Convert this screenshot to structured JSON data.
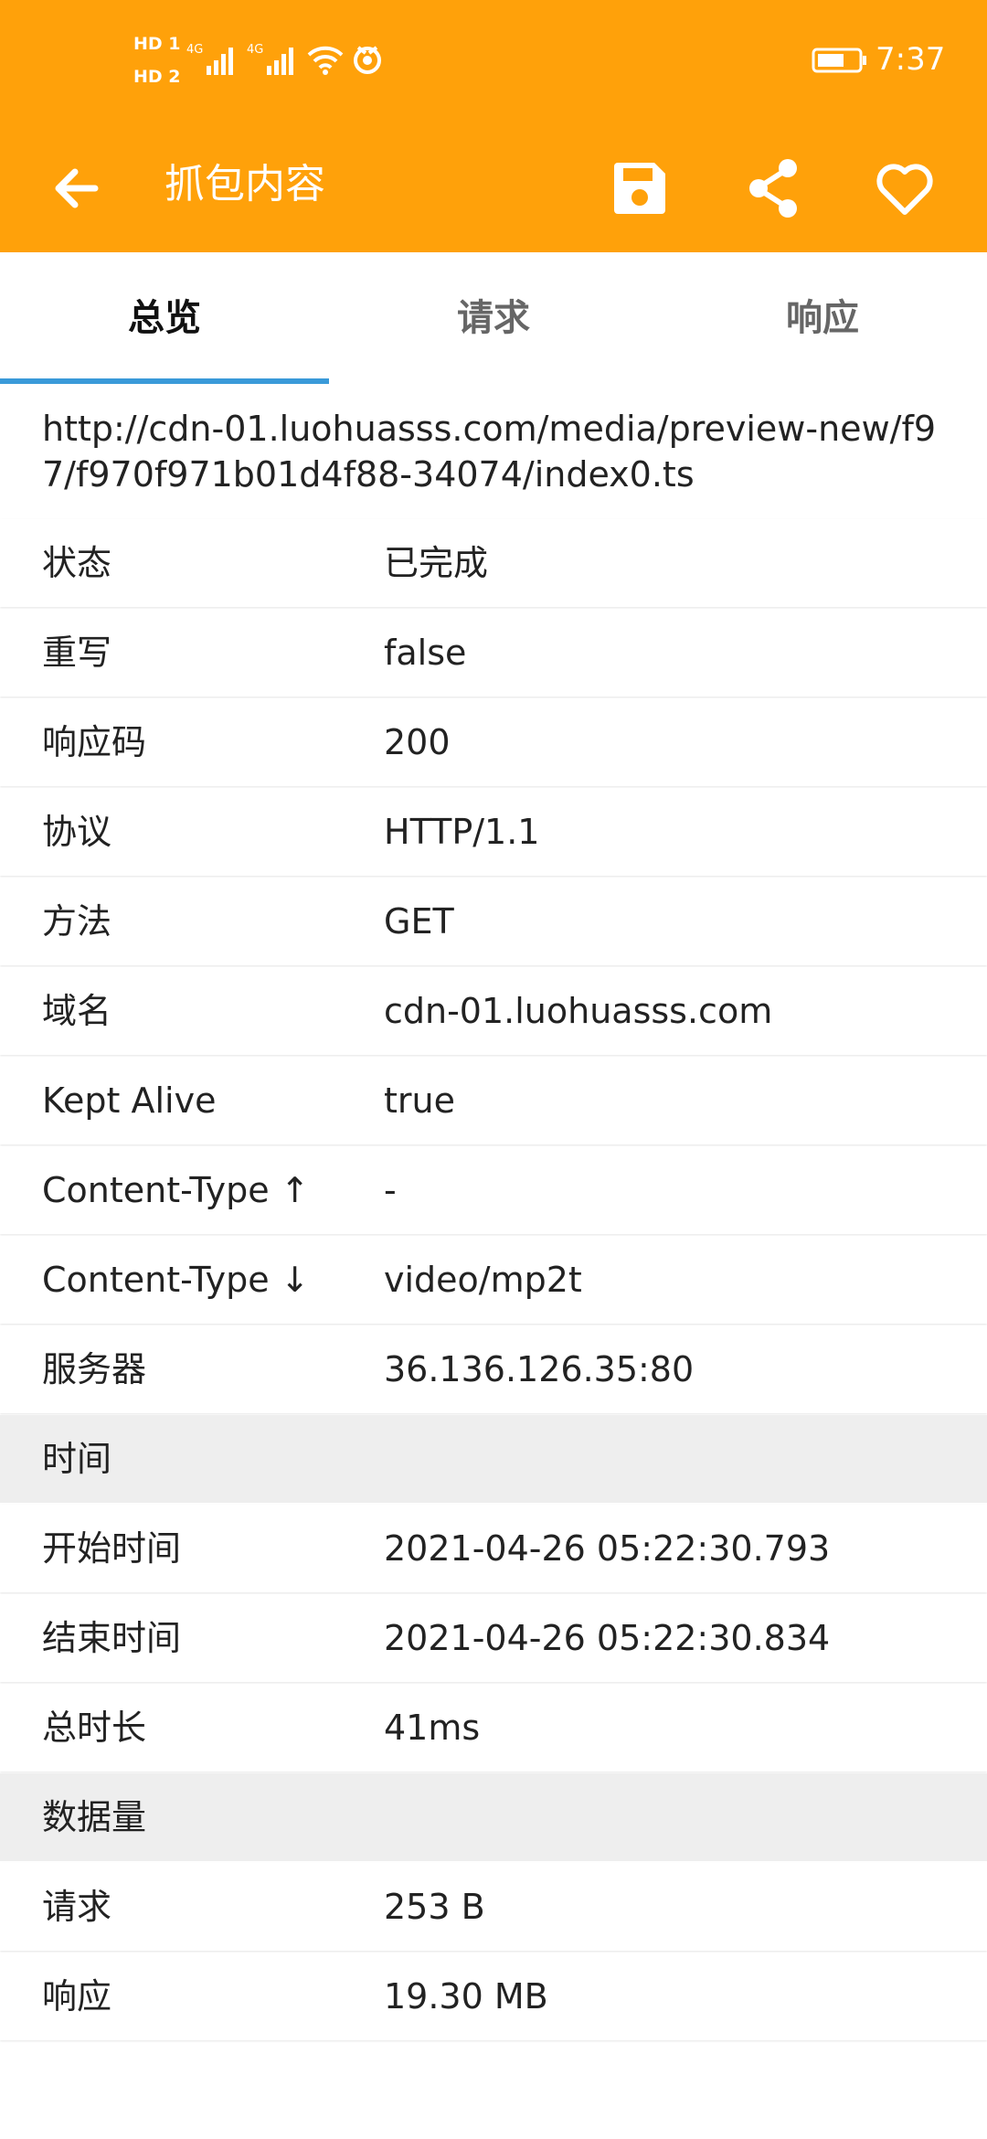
{
  "status_bar": {
    "hd1": "HD 1",
    "hd2": "HD 2",
    "network1": "4G",
    "network2": "4G",
    "time": "7:37"
  },
  "app_bar": {
    "title": "抓包内容",
    "icons": [
      "back-arrow-icon",
      "save-icon",
      "share-icon",
      "heart-icon"
    ]
  },
  "tabs": [
    {
      "label": "总览",
      "active": true
    },
    {
      "label": "请求",
      "active": false
    },
    {
      "label": "响应",
      "active": false
    }
  ],
  "url": "http://cdn-01.luohuasss.com/media/preview-new/f97/f970f971b01d4f88-34074/index0.ts",
  "overview": [
    {
      "label": "状态",
      "value": "已完成"
    },
    {
      "label": "重写",
      "value": "false"
    },
    {
      "label": "响应码",
      "value": "200"
    },
    {
      "label": "协议",
      "value": "HTTP/1.1"
    },
    {
      "label": "方法",
      "value": "GET"
    },
    {
      "label": "域名",
      "value": "cdn-01.luohuasss.com"
    },
    {
      "label": "Kept Alive",
      "value": "true"
    },
    {
      "label": "Content-Type ↑",
      "value": "-"
    },
    {
      "label": "Content-Type ↓",
      "value": "video/mp2t"
    },
    {
      "label": "服务器",
      "value": "36.136.126.35:80"
    }
  ],
  "time_section": {
    "title": "时间",
    "rows": [
      {
        "label": "开始时间",
        "value": "2021-04-26 05:22:30.793"
      },
      {
        "label": "结束时间",
        "value": "2021-04-26 05:22:30.834"
      },
      {
        "label": "总时长",
        "value": "41ms"
      }
    ]
  },
  "size_section": {
    "title": "数据量",
    "rows": [
      {
        "label": "请求",
        "value": "253 B"
      },
      {
        "label": "响应",
        "value": "19.30 MB"
      }
    ]
  },
  "colors": {
    "accent": "#FFA10A",
    "tab_indicator": "#3A9AD9",
    "section_background": "#EEEEEE"
  }
}
